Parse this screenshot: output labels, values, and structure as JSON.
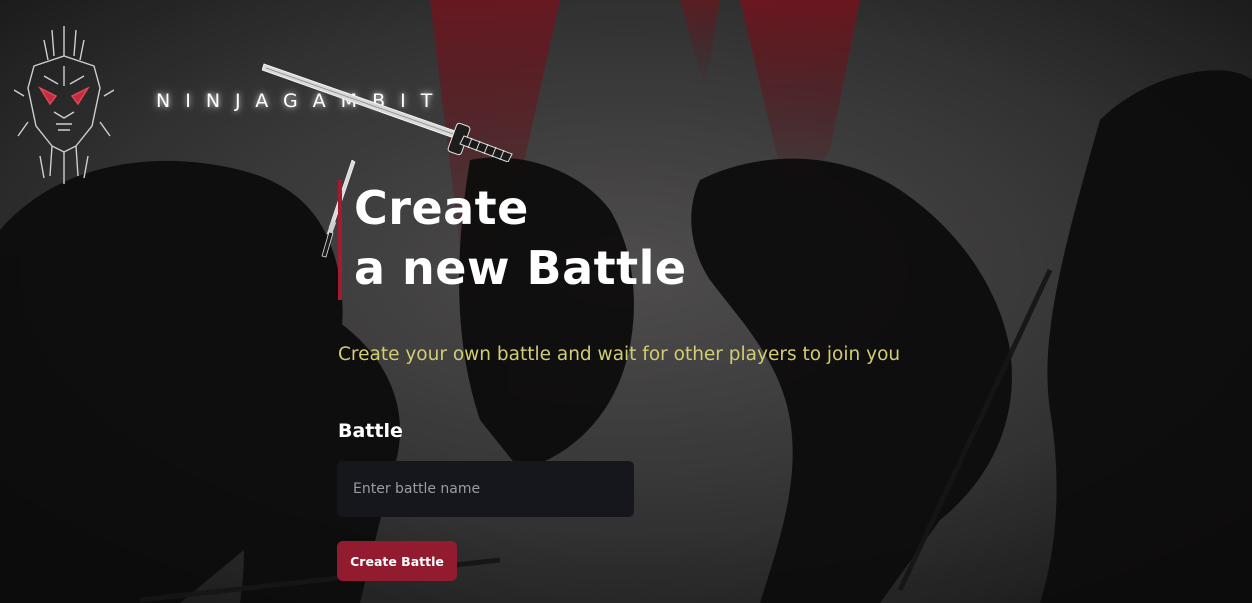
{
  "brand": {
    "name": "NINJAGAMBIT"
  },
  "hero": {
    "title_line1": "Create",
    "title_line2": "a new Battle",
    "subtitle": "Create your own battle and wait for other players to join you"
  },
  "form": {
    "label": "Battle",
    "input_value": "",
    "input_placeholder": "Enter battle name",
    "submit_label": "Create Battle"
  },
  "colors": {
    "accent": "#931b2f",
    "subtitle": "#d2cd72",
    "input_bg": "#15171c",
    "background": "#2b2a2a"
  },
  "icons": [
    "ninja-mask-logo-icon",
    "katana-icon",
    "small-sword-icon"
  ]
}
